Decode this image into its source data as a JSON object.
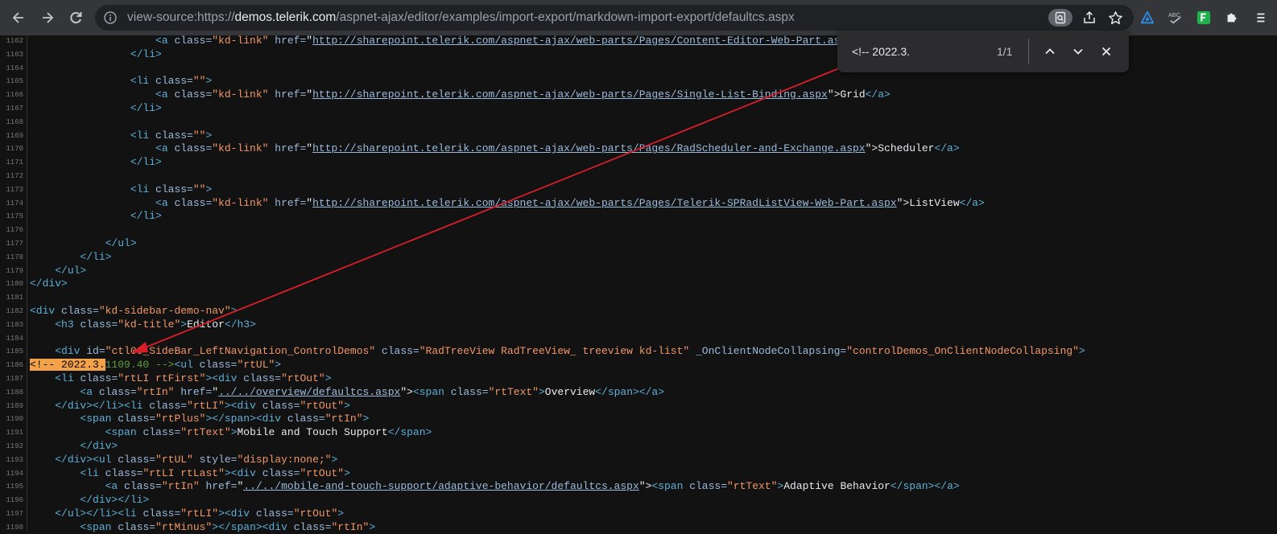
{
  "browser": {
    "url_prefix": "view-source:https://",
    "url_domain": "demos.telerik.com",
    "url_path": "/aspnet-ajax/editor/examples/import-export/markdown-import-export/defaultcs.aspx"
  },
  "find": {
    "query": "<!-- 2022.3.",
    "count": "1/1"
  },
  "lines": [
    {
      "n": "1162",
      "segs": [
        {
          "c": "",
          "t": "                    "
        },
        {
          "c": "tag",
          "t": "<a "
        },
        {
          "c": "attr",
          "t": "class="
        },
        {
          "c": "val",
          "t": "\"kd-link\""
        },
        {
          "c": "attr",
          "t": " href="
        },
        {
          "c": "",
          "t": "\""
        },
        {
          "c": "link",
          "t": "http://sharepoint.telerik.com/aspnet-ajax/web-parts/Pages/Content-Editor-Web-Part.aspx"
        },
        {
          "c": "",
          "t": "\">"
        }
      ]
    },
    {
      "n": "1163",
      "segs": [
        {
          "c": "",
          "t": "                "
        },
        {
          "c": "tag",
          "t": "</li>"
        }
      ]
    },
    {
      "n": "1164",
      "segs": []
    },
    {
      "n": "1165",
      "segs": [
        {
          "c": "",
          "t": "                "
        },
        {
          "c": "tag",
          "t": "<li "
        },
        {
          "c": "attr",
          "t": "class="
        },
        {
          "c": "val",
          "t": "\"\""
        },
        {
          "c": "tag",
          "t": ">"
        }
      ]
    },
    {
      "n": "1166",
      "segs": [
        {
          "c": "",
          "t": "                    "
        },
        {
          "c": "tag",
          "t": "<a "
        },
        {
          "c": "attr",
          "t": "class="
        },
        {
          "c": "val",
          "t": "\"kd-link\""
        },
        {
          "c": "attr",
          "t": " href="
        },
        {
          "c": "",
          "t": "\""
        },
        {
          "c": "link",
          "t": "http://sharepoint.telerik.com/aspnet-ajax/web-parts/Pages/Single-List-Binding.aspx"
        },
        {
          "c": "",
          "t": "\">Grid"
        },
        {
          "c": "tag",
          "t": "</a>"
        }
      ]
    },
    {
      "n": "1167",
      "segs": [
        {
          "c": "",
          "t": "                "
        },
        {
          "c": "tag",
          "t": "</li>"
        }
      ]
    },
    {
      "n": "1168",
      "segs": []
    },
    {
      "n": "1169",
      "segs": [
        {
          "c": "",
          "t": "                "
        },
        {
          "c": "tag",
          "t": "<li "
        },
        {
          "c": "attr",
          "t": "class="
        },
        {
          "c": "val",
          "t": "\"\""
        },
        {
          "c": "tag",
          "t": ">"
        }
      ]
    },
    {
      "n": "1170",
      "segs": [
        {
          "c": "",
          "t": "                    "
        },
        {
          "c": "tag",
          "t": "<a "
        },
        {
          "c": "attr",
          "t": "class="
        },
        {
          "c": "val",
          "t": "\"kd-link\""
        },
        {
          "c": "attr",
          "t": " href="
        },
        {
          "c": "",
          "t": "\""
        },
        {
          "c": "link",
          "t": "http://sharepoint.telerik.com/aspnet-ajax/web-parts/Pages/RadScheduler-and-Exchange.aspx"
        },
        {
          "c": "",
          "t": "\">Scheduler"
        },
        {
          "c": "tag",
          "t": "</a>"
        }
      ]
    },
    {
      "n": "1171",
      "segs": [
        {
          "c": "",
          "t": "                "
        },
        {
          "c": "tag",
          "t": "</li>"
        }
      ]
    },
    {
      "n": "1172",
      "segs": []
    },
    {
      "n": "1173",
      "segs": [
        {
          "c": "",
          "t": "                "
        },
        {
          "c": "tag",
          "t": "<li "
        },
        {
          "c": "attr",
          "t": "class="
        },
        {
          "c": "val",
          "t": "\"\""
        },
        {
          "c": "tag",
          "t": ">"
        }
      ]
    },
    {
      "n": "1174",
      "segs": [
        {
          "c": "",
          "t": "                    "
        },
        {
          "c": "tag",
          "t": "<a "
        },
        {
          "c": "attr",
          "t": "class="
        },
        {
          "c": "val",
          "t": "\"kd-link\""
        },
        {
          "c": "attr",
          "t": " href="
        },
        {
          "c": "",
          "t": "\""
        },
        {
          "c": "link",
          "t": "http://sharepoint.telerik.com/aspnet-ajax/web-parts/Pages/Telerik-SPRadListView-Web-Part.aspx"
        },
        {
          "c": "",
          "t": "\">ListView"
        },
        {
          "c": "tag",
          "t": "</a>"
        }
      ]
    },
    {
      "n": "1175",
      "segs": [
        {
          "c": "",
          "t": "                "
        },
        {
          "c": "tag",
          "t": "</li>"
        }
      ]
    },
    {
      "n": "1176",
      "segs": []
    },
    {
      "n": "1177",
      "segs": [
        {
          "c": "",
          "t": "            "
        },
        {
          "c": "tag",
          "t": "</ul>"
        }
      ]
    },
    {
      "n": "1178",
      "segs": [
        {
          "c": "",
          "t": "        "
        },
        {
          "c": "tag",
          "t": "</li>"
        }
      ]
    },
    {
      "n": "1179",
      "segs": [
        {
          "c": "",
          "t": "    "
        },
        {
          "c": "tag",
          "t": "</ul>"
        }
      ]
    },
    {
      "n": "1180",
      "segs": [
        {
          "c": "tag",
          "t": "</div>"
        }
      ]
    },
    {
      "n": "1181",
      "segs": []
    },
    {
      "n": "1182",
      "segs": [
        {
          "c": "tag",
          "t": "<div "
        },
        {
          "c": "attr",
          "t": "class="
        },
        {
          "c": "val",
          "t": "\"kd-sidebar-demo-nav\""
        },
        {
          "c": "tag",
          "t": ">"
        }
      ]
    },
    {
      "n": "1183",
      "segs": [
        {
          "c": "",
          "t": "    "
        },
        {
          "c": "tag",
          "t": "<h3 "
        },
        {
          "c": "attr",
          "t": "class="
        },
        {
          "c": "val",
          "t": "\"kd-title\""
        },
        {
          "c": "tag",
          "t": ">"
        },
        {
          "c": "",
          "t": "Editor"
        },
        {
          "c": "tag",
          "t": "</h3>"
        }
      ]
    },
    {
      "n": "1184",
      "segs": []
    },
    {
      "n": "1185",
      "segs": [
        {
          "c": "",
          "t": "    "
        },
        {
          "c": "tag",
          "t": "<div "
        },
        {
          "c": "attr",
          "t": "id="
        },
        {
          "c": "val",
          "t": "\"ctl00_SideBar_LeftNavigation_ControlDemos\""
        },
        {
          "c": "attr",
          "t": " class="
        },
        {
          "c": "val",
          "t": "\"RadTreeView RadTreeView_ treeview kd-list\""
        },
        {
          "c": "attr",
          "t": " _OnClientNodeCollapsing="
        },
        {
          "c": "val",
          "t": "\"controlDemos_OnClientNodeCollapsing\""
        },
        {
          "c": "tag",
          "t": ">"
        }
      ]
    },
    {
      "n": "1186",
      "segs": [
        {
          "c": "hl",
          "t": "<!-- 2022.3."
        },
        {
          "c": "cm",
          "t": "1109.40 -->"
        },
        {
          "c": "tag",
          "t": "<ul "
        },
        {
          "c": "attr",
          "t": "class="
        },
        {
          "c": "val",
          "t": "\"rtUL\""
        },
        {
          "c": "tag",
          "t": ">"
        }
      ]
    },
    {
      "n": "1187",
      "segs": [
        {
          "c": "",
          "t": "    "
        },
        {
          "c": "tag",
          "t": "<li "
        },
        {
          "c": "attr",
          "t": "class="
        },
        {
          "c": "val",
          "t": "\"rtLI rtFirst\""
        },
        {
          "c": "tag",
          "t": "><div "
        },
        {
          "c": "attr",
          "t": "class="
        },
        {
          "c": "val",
          "t": "\"rtOut\""
        },
        {
          "c": "tag",
          "t": ">"
        }
      ]
    },
    {
      "n": "1188",
      "segs": [
        {
          "c": "",
          "t": "        "
        },
        {
          "c": "tag",
          "t": "<a "
        },
        {
          "c": "attr",
          "t": "class="
        },
        {
          "c": "val",
          "t": "\"rtIn\""
        },
        {
          "c": "attr",
          "t": " href="
        },
        {
          "c": "",
          "t": "\""
        },
        {
          "c": "link",
          "t": "../../overview/defaultcs.aspx"
        },
        {
          "c": "",
          "t": "\">"
        },
        {
          "c": "tag",
          "t": "<span "
        },
        {
          "c": "attr",
          "t": "class="
        },
        {
          "c": "val",
          "t": "\"rtText\""
        },
        {
          "c": "tag",
          "t": ">"
        },
        {
          "c": "",
          "t": "Overview"
        },
        {
          "c": "tag",
          "t": "</span></a>"
        }
      ]
    },
    {
      "n": "1189",
      "segs": [
        {
          "c": "",
          "t": "    "
        },
        {
          "c": "tag",
          "t": "</div></li><li "
        },
        {
          "c": "attr",
          "t": "class="
        },
        {
          "c": "val",
          "t": "\"rtLI\""
        },
        {
          "c": "tag",
          "t": "><div "
        },
        {
          "c": "attr",
          "t": "class="
        },
        {
          "c": "val",
          "t": "\"rtOut\""
        },
        {
          "c": "tag",
          "t": ">"
        }
      ]
    },
    {
      "n": "1190",
      "segs": [
        {
          "c": "",
          "t": "        "
        },
        {
          "c": "tag",
          "t": "<span "
        },
        {
          "c": "attr",
          "t": "class="
        },
        {
          "c": "val",
          "t": "\"rtPlus\""
        },
        {
          "c": "tag",
          "t": "></span><div "
        },
        {
          "c": "attr",
          "t": "class="
        },
        {
          "c": "val",
          "t": "\"rtIn\""
        },
        {
          "c": "tag",
          "t": ">"
        }
      ]
    },
    {
      "n": "1191",
      "segs": [
        {
          "c": "",
          "t": "            "
        },
        {
          "c": "tag",
          "t": "<span "
        },
        {
          "c": "attr",
          "t": "class="
        },
        {
          "c": "val",
          "t": "\"rtText\""
        },
        {
          "c": "tag",
          "t": ">"
        },
        {
          "c": "",
          "t": "Mobile and Touch Support"
        },
        {
          "c": "tag",
          "t": "</span>"
        }
      ]
    },
    {
      "n": "1192",
      "segs": [
        {
          "c": "",
          "t": "        "
        },
        {
          "c": "tag",
          "t": "</div>"
        }
      ]
    },
    {
      "n": "1193",
      "segs": [
        {
          "c": "",
          "t": "    "
        },
        {
          "c": "tag",
          "t": "</div><ul "
        },
        {
          "c": "attr",
          "t": "class="
        },
        {
          "c": "val",
          "t": "\"rtUL\""
        },
        {
          "c": "attr",
          "t": " style="
        },
        {
          "c": "val",
          "t": "\"display:none;\""
        },
        {
          "c": "tag",
          "t": ">"
        }
      ]
    },
    {
      "n": "1194",
      "segs": [
        {
          "c": "",
          "t": "        "
        },
        {
          "c": "tag",
          "t": "<li "
        },
        {
          "c": "attr",
          "t": "class="
        },
        {
          "c": "val",
          "t": "\"rtLI rtLast\""
        },
        {
          "c": "tag",
          "t": "><div "
        },
        {
          "c": "attr",
          "t": "class="
        },
        {
          "c": "val",
          "t": "\"rtOut\""
        },
        {
          "c": "tag",
          "t": ">"
        }
      ]
    },
    {
      "n": "1195",
      "segs": [
        {
          "c": "",
          "t": "            "
        },
        {
          "c": "tag",
          "t": "<a "
        },
        {
          "c": "attr",
          "t": "class="
        },
        {
          "c": "val",
          "t": "\"rtIn\""
        },
        {
          "c": "attr",
          "t": " href="
        },
        {
          "c": "",
          "t": "\""
        },
        {
          "c": "link",
          "t": "../../mobile-and-touch-support/adaptive-behavior/defaultcs.aspx"
        },
        {
          "c": "",
          "t": "\">"
        },
        {
          "c": "tag",
          "t": "<span "
        },
        {
          "c": "attr",
          "t": "class="
        },
        {
          "c": "val",
          "t": "\"rtText\""
        },
        {
          "c": "tag",
          "t": ">"
        },
        {
          "c": "",
          "t": "Adaptive Behavior"
        },
        {
          "c": "tag",
          "t": "</span></a>"
        }
      ]
    },
    {
      "n": "1196",
      "segs": [
        {
          "c": "",
          "t": "        "
        },
        {
          "c": "tag",
          "t": "</div></li>"
        }
      ]
    },
    {
      "n": "1197",
      "segs": [
        {
          "c": "",
          "t": "    "
        },
        {
          "c": "tag",
          "t": "</ul></li><li "
        },
        {
          "c": "attr",
          "t": "class="
        },
        {
          "c": "val",
          "t": "\"rtLI\""
        },
        {
          "c": "tag",
          "t": "><div "
        },
        {
          "c": "attr",
          "t": "class="
        },
        {
          "c": "val",
          "t": "\"rtOut\""
        },
        {
          "c": "tag",
          "t": ">"
        }
      ]
    },
    {
      "n": "1198",
      "segs": [
        {
          "c": "",
          "t": "        "
        },
        {
          "c": "tag",
          "t": "<span "
        },
        {
          "c": "attr",
          "t": "class="
        },
        {
          "c": "val",
          "t": "\"rtMinus\""
        },
        {
          "c": "tag",
          "t": "></span><div "
        },
        {
          "c": "attr",
          "t": "class="
        },
        {
          "c": "val",
          "t": "\"rtIn\""
        },
        {
          "c": "tag",
          "t": ">"
        }
      ]
    }
  ]
}
